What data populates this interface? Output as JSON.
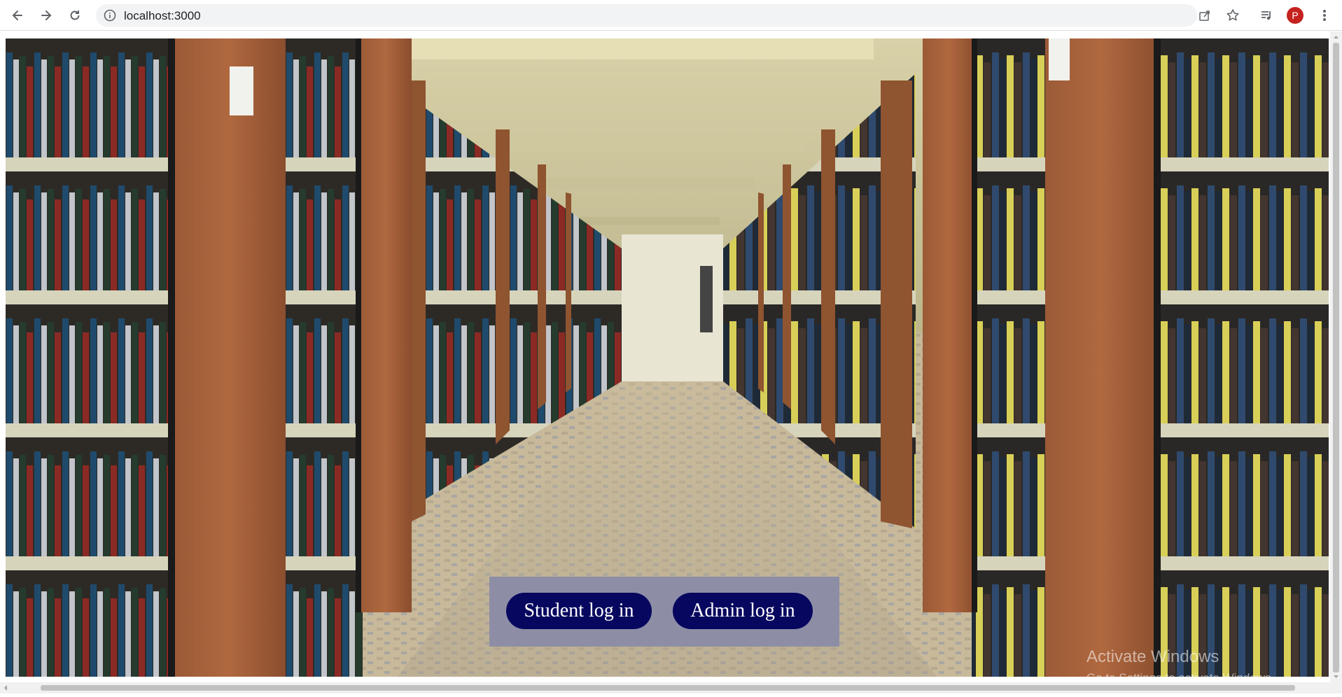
{
  "browser": {
    "url": "localhost:3000",
    "profile_initial": "P",
    "icons": {
      "back": "back-arrow-icon",
      "forward": "forward-arrow-icon",
      "reload": "reload-icon",
      "site_info": "info-icon",
      "share": "share-icon",
      "bookmark": "star-icon",
      "reading_list": "reading-list-icon",
      "menu": "kebab-menu-icon"
    }
  },
  "page": {
    "background": "library-bookshelves-photo",
    "buttons": {
      "student": "Student log in",
      "admin": "Admin log in"
    },
    "colors": {
      "panel": "#8d8ea6",
      "button": "#07075f",
      "button_text": "#ffffff"
    }
  },
  "overlay": {
    "title": "Activate Windows",
    "subtitle": "Go to Settings to activate Windows."
  }
}
